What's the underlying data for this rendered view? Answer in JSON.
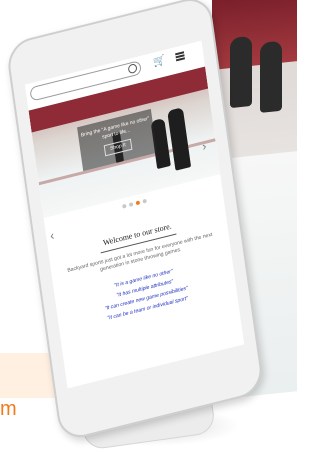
{
  "corner_text": "m",
  "store": {
    "hero_caption_line1": "Bring the \"A game like no other\"",
    "hero_caption_line2": "sport to life...",
    "hero_button": "Shop It"
  },
  "welcome": "Welcome to our store.",
  "intro": "Backyard sports just got a lot more fun for everyone with the next generation in stone throwing games.",
  "quotes": [
    "\"It is a game like no other\"",
    "\"It has multiple attributes\"",
    "\"It can create new game possibilities\"",
    "\"It can be a team or individual sport\""
  ],
  "icons": {
    "search": "search-icon",
    "cart": "cart-icon",
    "menu": "menu-icon",
    "prev": "chevron-left-icon",
    "next": "chevron-right-icon"
  },
  "colors": {
    "accent": "#f07d1a",
    "quote_blue": "#1f2fbf",
    "rink_roof": "#8f2b37"
  },
  "carousel": {
    "slide_count": 4,
    "active_index": 2
  }
}
